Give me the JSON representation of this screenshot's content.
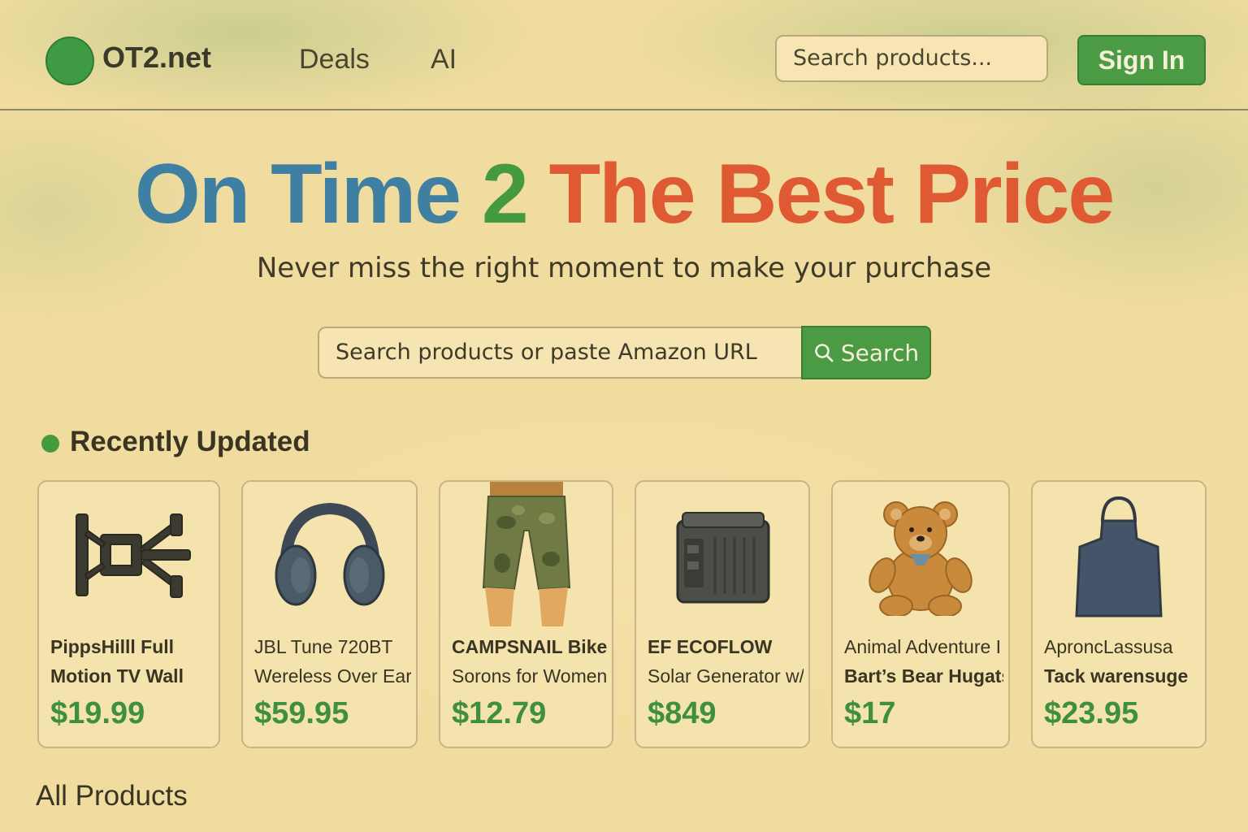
{
  "header": {
    "logo_text": "OT2.net",
    "nav": [
      "Deals",
      "AI"
    ],
    "search_placeholder": "Search products...",
    "signin_label": "Sign In"
  },
  "hero": {
    "title_part1": "On Time ",
    "title_part2": "2",
    "title_part3": " The Best Price",
    "subtitle": "Never miss the right moment to make your purchase",
    "search_placeholder": "Search products or paste Amazon URL",
    "search_button": "Search"
  },
  "recent": {
    "title": "Recently Updated",
    "products": [
      {
        "line1": "PippsHilll Full",
        "line2": "Motion TV Wall",
        "price": "$19.99",
        "icon": "tv-mount-icon"
      },
      {
        "line1": "JBL Tune 720BT",
        "line2": "Wereless Over Ear",
        "price": "$59.95",
        "icon": "headphones-icon"
      },
      {
        "line1": "CAMPSNAIL Bike",
        "line2": "Sorons for Women",
        "price": "$12.79",
        "icon": "bike-shorts-icon"
      },
      {
        "line1": "EF ECOFLOW",
        "line2": "Solar Generator w/",
        "price": "$849",
        "icon": "power-station-icon"
      },
      {
        "line1": "Animal Adventure I",
        "line2": "Bart’s Bear Hugats",
        "price": "$17",
        "icon": "teddy-bear-icon"
      },
      {
        "line1": "AproncLassusa",
        "line2": "Tack warensuge",
        "price": "$23.95",
        "icon": "apron-icon"
      }
    ]
  },
  "all_products": {
    "title": "All Products"
  },
  "colors": {
    "background": "#f1dca0",
    "accent_green": "#4b9a44",
    "title_blue": "#3f7fa2",
    "title_green": "#45993f",
    "title_red": "#df5a33",
    "price_green": "#3e8f3f"
  }
}
